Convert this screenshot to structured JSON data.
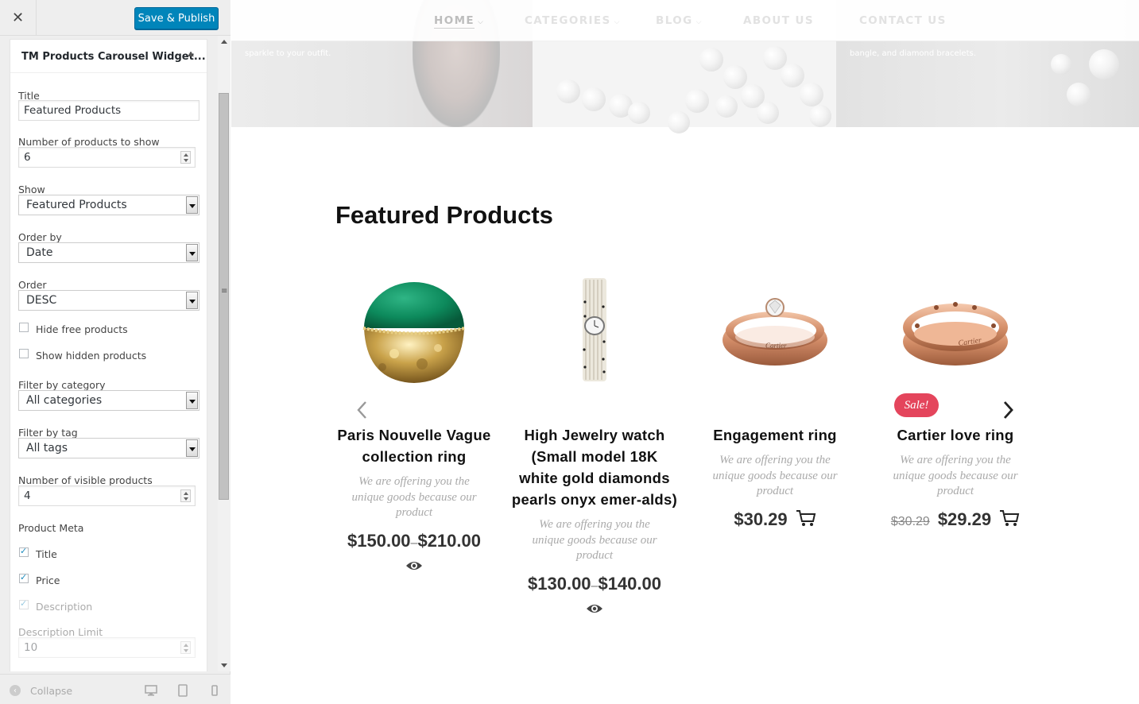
{
  "sidebar": {
    "close_icon": "close-icon",
    "publish_label": "Save & Publish",
    "widget_title": "TM Products Carousel Widget...",
    "fields": {
      "title_label": "Title",
      "title_value": "Featured Products",
      "num_products_label": "Number of products to show",
      "num_products_value": "6",
      "show_label": "Show",
      "show_value": "Featured Products",
      "orderby_label": "Order by",
      "orderby_value": "Date",
      "order_label": "Order",
      "order_value": "DESC",
      "hide_free_label": "Hide free products",
      "show_hidden_label": "Show hidden products",
      "filter_cat_label": "Filter by category",
      "filter_cat_value": "All categories",
      "filter_tag_label": "Filter by tag",
      "filter_tag_value": "All tags",
      "visible_label": "Number of visible products",
      "visible_value": "4",
      "meta_label": "Product Meta",
      "meta_title": "Title",
      "meta_price": "Price",
      "meta_desc": "Description",
      "desc_limit_label": "Description Limit",
      "desc_limit_value": "10"
    },
    "collapse_label": "Collapse"
  },
  "nav": {
    "items": [
      "HOME",
      "CATEGORIES",
      "BLOG",
      "ABOUT US",
      "CONTACT US"
    ]
  },
  "hero": {
    "left_text_1": "sparkle to your outfit.",
    "right_text_1": "bangle, and diamond bracelets."
  },
  "section_title": "Featured Products",
  "products": [
    {
      "title": "Paris Nouvelle Vague collection ring",
      "desc": "We are offering you the unique goods because our product",
      "price_from": "$150.00",
      "price_to": "$210.00",
      "price_sep": "–"
    },
    {
      "title": "High Jewelry watch (Small model 18K white gold diamonds pearls onyx emer-alds)",
      "desc": "We are offering you the unique goods because our product",
      "price_from": "$130.00",
      "price_to": "$140.00",
      "price_sep": "–"
    },
    {
      "title": "Engagement ring",
      "desc": "We are offering you the unique goods because our product",
      "price": "$30.29"
    },
    {
      "title": "Cartier love ring",
      "desc": "We are offering you the unique goods because our product",
      "old_price": "$30.29",
      "price": "$29.29",
      "badge": "Sale!"
    }
  ],
  "colors": {
    "publish_blue": "#0085ba",
    "sale_red": "#e4455c"
  }
}
